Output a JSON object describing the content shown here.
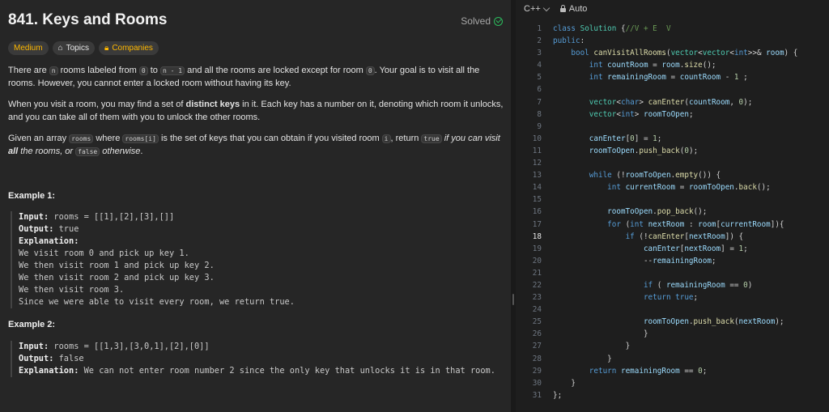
{
  "problem": {
    "title": "841. Keys and Rooms",
    "status": "Solved",
    "tags": {
      "difficulty": "Medium",
      "topics": "Topics",
      "companies": "Companies"
    },
    "para1": {
      "t1": "There are ",
      "c1": "n",
      "t2": " rooms labeled from ",
      "c2": "0",
      "t3": " to ",
      "c3": "n - 1",
      "t4": " and all the rooms are locked except for room ",
      "c4": "0",
      "t5": ". Your goal is to visit all the rooms. However, you cannot enter a locked room without having its key."
    },
    "para2": {
      "t1": "When you visit a room, you may find a set of ",
      "b1": "distinct keys",
      "t2": " in it. Each key has a number on it, denoting which room it unlocks, and you can take all of them with you to unlock the other rooms."
    },
    "para3": {
      "t1": "Given an array ",
      "c1": "rooms",
      "t2": " where ",
      "c2": "rooms[i]",
      "t3": " is the set of keys that you can obtain if you visited room ",
      "c3": "i",
      "t4": ", return ",
      "c4": "true",
      "i1": " if you can visit ",
      "ib": "all",
      "i2": " the rooms, or ",
      "c5": "false",
      "i3": " otherwise",
      "t5": "."
    },
    "example1": {
      "heading": "Example 1:",
      "input_label": "Input:",
      "input": " rooms = [[1],[2],[3],[]]",
      "output_label": "Output:",
      "output": " true",
      "explanation_label": "Explanation:",
      "lines": [
        "We visit room 0 and pick up key 1.",
        "We then visit room 1 and pick up key 2.",
        "We then visit room 2 and pick up key 3.",
        "We then visit room 3.",
        "Since we were able to visit every room, we return true."
      ]
    },
    "example2": {
      "heading": "Example 2:",
      "input_label": "Input:",
      "input": " rooms = [[1,3],[3,0,1],[2],[0]]",
      "output_label": "Output:",
      "output": " false",
      "explanation_label": "Explanation:",
      "explanation": " We can not enter room number 2 since the only key that unlocks it is in that room."
    }
  },
  "editor": {
    "language": "C++",
    "mode": "Auto",
    "active_line": 18,
    "lines": [
      {
        "n": "1",
        "indent": "",
        "tokens": [
          [
            "kw",
            "class "
          ],
          [
            "ty",
            "Solution "
          ],
          [
            "",
            "{"
          ],
          [
            "cmt",
            "//V + E  V"
          ]
        ]
      },
      {
        "n": "2",
        "indent": "",
        "tokens": [
          [
            "kw",
            "public"
          ],
          [
            "",
            ":"
          ]
        ]
      },
      {
        "n": "3",
        "indent": "    ",
        "tokens": [
          [
            "kw",
            "bool "
          ],
          [
            "fn",
            "canVisitAllRooms"
          ],
          [
            "",
            "("
          ],
          [
            "ty",
            "vector"
          ],
          [
            "",
            "<"
          ],
          [
            "ty",
            "vector"
          ],
          [
            "",
            "<"
          ],
          [
            "kw",
            "int"
          ],
          [
            "",
            ">>& "
          ],
          [
            "vr",
            "room"
          ],
          [
            "",
            ") {"
          ]
        ]
      },
      {
        "n": "4",
        "indent": "        ",
        "tokens": [
          [
            "kw",
            "int "
          ],
          [
            "vr",
            "countRoom"
          ],
          [
            "",
            " = "
          ],
          [
            "vr",
            "room"
          ],
          [
            "",
            "."
          ],
          [
            "fn",
            "size"
          ],
          [
            "",
            "();"
          ]
        ]
      },
      {
        "n": "5",
        "indent": "        ",
        "tokens": [
          [
            "kw",
            "int "
          ],
          [
            "vr",
            "remainingRoom"
          ],
          [
            "",
            " = "
          ],
          [
            "vr",
            "countRoom"
          ],
          [
            "",
            " - "
          ],
          [
            "num",
            "1"
          ],
          [
            "",
            " ;"
          ]
        ]
      },
      {
        "n": "6",
        "indent": "",
        "tokens": []
      },
      {
        "n": "7",
        "indent": "        ",
        "tokens": [
          [
            "ty",
            "vector"
          ],
          [
            "",
            "<"
          ],
          [
            "kw",
            "char"
          ],
          [
            "",
            "> "
          ],
          [
            "fn",
            "canEnter"
          ],
          [
            "",
            "("
          ],
          [
            "vr",
            "countRoom"
          ],
          [
            "",
            ", "
          ],
          [
            "num",
            "0"
          ],
          [
            "",
            ");"
          ]
        ]
      },
      {
        "n": "8",
        "indent": "        ",
        "tokens": [
          [
            "ty",
            "vector"
          ],
          [
            "",
            "<"
          ],
          [
            "kw",
            "int"
          ],
          [
            "",
            "> "
          ],
          [
            "vr",
            "roomToOpen"
          ],
          [
            "",
            ";"
          ]
        ]
      },
      {
        "n": "9",
        "indent": "",
        "tokens": []
      },
      {
        "n": "10",
        "indent": "        ",
        "tokens": [
          [
            "vr",
            "canEnter"
          ],
          [
            "",
            "["
          ],
          [
            "num",
            "0"
          ],
          [
            "",
            "] = "
          ],
          [
            "num",
            "1"
          ],
          [
            "",
            ";"
          ]
        ]
      },
      {
        "n": "11",
        "indent": "        ",
        "tokens": [
          [
            "vr",
            "roomToOpen"
          ],
          [
            "",
            "."
          ],
          [
            "fn",
            "push_back"
          ],
          [
            "",
            "("
          ],
          [
            "num",
            "0"
          ],
          [
            "",
            ");"
          ]
        ]
      },
      {
        "n": "12",
        "indent": "",
        "tokens": []
      },
      {
        "n": "13",
        "indent": "        ",
        "tokens": [
          [
            "kw",
            "while "
          ],
          [
            "",
            "(!"
          ],
          [
            "vr",
            "roomToOpen"
          ],
          [
            "",
            "."
          ],
          [
            "fn",
            "empty"
          ],
          [
            "",
            "()) {"
          ]
        ]
      },
      {
        "n": "14",
        "indent": "            ",
        "tokens": [
          [
            "kw",
            "int "
          ],
          [
            "vr",
            "currentRoom"
          ],
          [
            "",
            " = "
          ],
          [
            "vr",
            "roomToOpen"
          ],
          [
            "",
            "."
          ],
          [
            "fn",
            "back"
          ],
          [
            "",
            "();"
          ]
        ]
      },
      {
        "n": "15",
        "indent": "",
        "tokens": []
      },
      {
        "n": "16",
        "indent": "            ",
        "tokens": [
          [
            "vr",
            "roomToOpen"
          ],
          [
            "",
            "."
          ],
          [
            "fn",
            "pop_back"
          ],
          [
            "",
            "();"
          ]
        ]
      },
      {
        "n": "17",
        "indent": "            ",
        "tokens": [
          [
            "kw",
            "for "
          ],
          [
            "",
            "("
          ],
          [
            "kw",
            "int "
          ],
          [
            "vr",
            "nextRoom"
          ],
          [
            "",
            " : "
          ],
          [
            "vr",
            "room"
          ],
          [
            "",
            "["
          ],
          [
            "vr",
            "currentRoom"
          ],
          [
            "",
            "]){"
          ]
        ]
      },
      {
        "n": "18",
        "indent": "                ",
        "tokens": [
          [
            "kw",
            "if "
          ],
          [
            "",
            "(!"
          ],
          [
            "fn",
            "canEnter"
          ],
          [
            "",
            "["
          ],
          [
            "vr",
            "nextRoom"
          ],
          [
            "",
            "]) {"
          ]
        ]
      },
      {
        "n": "19",
        "indent": "                    ",
        "tokens": [
          [
            "vr",
            "canEnter"
          ],
          [
            "",
            "["
          ],
          [
            "vr",
            "nextRoom"
          ],
          [
            "",
            "] = "
          ],
          [
            "num",
            "1"
          ],
          [
            "",
            ";"
          ]
        ]
      },
      {
        "n": "20",
        "indent": "                    ",
        "tokens": [
          [
            "",
            "--"
          ],
          [
            "vr",
            "remainingRoom"
          ],
          [
            "",
            ";"
          ]
        ]
      },
      {
        "n": "21",
        "indent": "",
        "tokens": []
      },
      {
        "n": "22",
        "indent": "                    ",
        "tokens": [
          [
            "kw",
            "if "
          ],
          [
            "",
            "( "
          ],
          [
            "vr",
            "remainingRoom"
          ],
          [
            "",
            " == "
          ],
          [
            "num",
            "0"
          ],
          [
            "",
            ")"
          ]
        ]
      },
      {
        "n": "23",
        "indent": "                    ",
        "tokens": [
          [
            "kw",
            "return "
          ],
          [
            "kw",
            "true"
          ],
          [
            "",
            ";"
          ]
        ]
      },
      {
        "n": "24",
        "indent": "",
        "tokens": []
      },
      {
        "n": "25",
        "indent": "                    ",
        "tokens": [
          [
            "vr",
            "roomToOpen"
          ],
          [
            "",
            "."
          ],
          [
            "fn",
            "push_back"
          ],
          [
            "",
            "("
          ],
          [
            "vr",
            "nextRoom"
          ],
          [
            "",
            ");"
          ]
        ]
      },
      {
        "n": "26",
        "indent": "                    ",
        "tokens": [
          [
            "",
            "}"
          ]
        ]
      },
      {
        "n": "27",
        "indent": "                ",
        "tokens": [
          [
            "",
            "}"
          ]
        ]
      },
      {
        "n": "28",
        "indent": "            ",
        "tokens": [
          [
            "",
            "}"
          ]
        ]
      },
      {
        "n": "29",
        "indent": "        ",
        "tokens": [
          [
            "kw",
            "return "
          ],
          [
            "vr",
            "remainingRoom"
          ],
          [
            "",
            " == "
          ],
          [
            "num",
            "0"
          ],
          [
            "",
            ";"
          ]
        ]
      },
      {
        "n": "30",
        "indent": "    ",
        "tokens": [
          [
            "",
            "}"
          ]
        ]
      },
      {
        "n": "31",
        "indent": "",
        "tokens": [
          [
            "",
            "};"
          ]
        ]
      }
    ]
  }
}
